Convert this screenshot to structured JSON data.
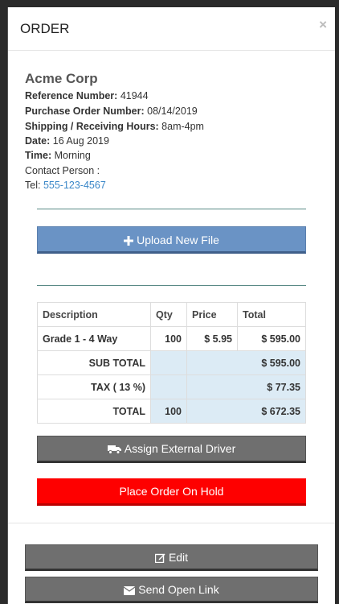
{
  "modal": {
    "title": "ORDER",
    "close_label": "×"
  },
  "customer": {
    "company": "Acme Corp",
    "reference_label": "Reference Number:",
    "reference_value": "41944",
    "po_label": "Purchase Order Number:",
    "po_value": "08/14/2019",
    "hours_label": "Shipping / Receiving Hours:",
    "hours_value": "8am-4pm",
    "date_label": "Date:",
    "date_value": "16 Aug 2019",
    "time_label": "Time:",
    "time_value": "Morning",
    "contact_label": "Contact Person :",
    "tel_label": "Tel:",
    "tel_value": "555-123-4567"
  },
  "buttons": {
    "upload": "Upload New File",
    "assign_driver": "Assign External Driver",
    "place_hold": "Place Order On Hold",
    "edit": "Edit",
    "send_link": "Send Open Link"
  },
  "table": {
    "headers": [
      "Description",
      "Qty",
      "Price",
      "Total"
    ],
    "rows": [
      {
        "description": "Grade 1 - 4 Way",
        "qty": "100",
        "price": "$ 5.95",
        "total": "$ 595.00"
      }
    ],
    "subtotal_label": "SUB TOTAL",
    "subtotal_value": "$ 595.00",
    "tax_label": "TAX ( 13 %)",
    "tax_value": "$ 77.35",
    "total_label": "TOTAL",
    "total_qty": "100",
    "total_value": "$ 672.35"
  },
  "colors": {
    "accent_blue": "#6a93c5",
    "danger_red": "#fe0000",
    "button_gray": "#6f6f6f",
    "link_blue": "#3a87c8"
  },
  "icons": {
    "upload": "plus-icon",
    "driver": "truck-icon",
    "edit": "edit-icon",
    "send": "envelope-icon",
    "close": "close-icon"
  }
}
